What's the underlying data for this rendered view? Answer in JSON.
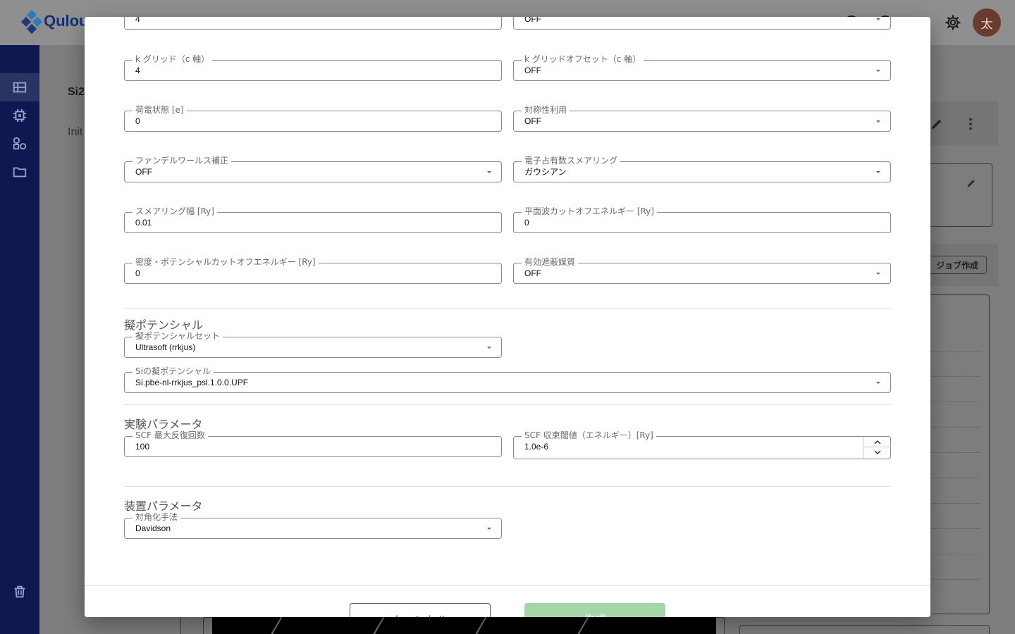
{
  "app": {
    "brand": "Qulou",
    "avatar_initial": "太",
    "page_title": "Si2",
    "page_subtitle": "Init",
    "job_button": "ジョブ作成"
  },
  "icons": {
    "sidebar": [
      "dashboard-icon",
      "chip-icon",
      "models-icon",
      "folder-icon",
      "trash-icon"
    ],
    "appbar": [
      "help-icon",
      "notification-icon",
      "tools-icon",
      "gear-icon"
    ]
  },
  "colors": {
    "sidebar_bg": "#0f1850",
    "create_button_disabled": "#a5d6a7",
    "avatar_bg": "#6b3c2e"
  },
  "form": {
    "top_left_value": "4",
    "top_right_value": "OFF",
    "kgrid_c": {
      "label": "k グリッド（c 軸）",
      "value": "4"
    },
    "kgrid_offset_c": {
      "label": "k グリッドオフセット（c 軸）",
      "value": "OFF"
    },
    "charge": {
      "label": "荷電状態 [e]",
      "value": "0"
    },
    "symmetry": {
      "label": "対称性利用",
      "value": "OFF"
    },
    "vdw": {
      "label": "ファンデルワールス補正",
      "value": "OFF"
    },
    "smearing_type": {
      "label": "電子占有数スメアリング",
      "value": "ガウシアン"
    },
    "smearing_width": {
      "label": "スメアリング幅 [Ry]",
      "value": "0.01"
    },
    "pw_cutoff": {
      "label": "平面波カットオフエネルギー [Ry]",
      "value": "0"
    },
    "density_cutoff": {
      "label": "密度・ポテンシャルカットオフエネルギー [Ry]",
      "value": "0"
    },
    "screening": {
      "label": "有効遮蔽媒質",
      "value": "OFF"
    }
  },
  "pseudo": {
    "title": "擬ポテンシャル",
    "set": {
      "label": "擬ポテンシャルセット",
      "value": "Ultrasoft (rrkjus)"
    },
    "si": {
      "label": "Siの擬ポテンシャル",
      "value": "Si.pbe-nl-rrkjus_psl.1.0.0.UPF"
    }
  },
  "experiment": {
    "title": "実験パラメータ",
    "scf_max": {
      "label": "SCF 最大反復回数",
      "value": "100"
    },
    "scf_conv": {
      "label": "SCF 収束閾値（エネルギー）[Ry]",
      "value": "1.0e-6"
    }
  },
  "device": {
    "title": "装置パラメータ",
    "diag": {
      "label": "対角化手法",
      "value": "Davidson"
    }
  },
  "footer": {
    "cancel": "キャンセル",
    "create": "作成"
  }
}
